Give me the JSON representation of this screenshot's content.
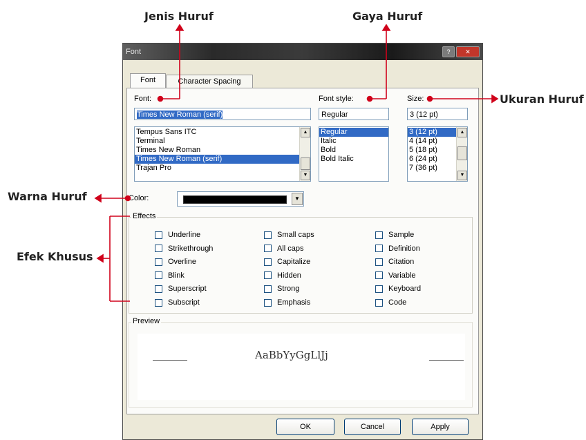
{
  "annotations": {
    "font_type": "Jenis Huruf",
    "font_style": "Gaya Huruf",
    "font_size": "Ukuran Huruf",
    "font_color": "Warna Huruf",
    "effects": "Efek Khusus",
    "accent_color": "#d0021b"
  },
  "dialog": {
    "title": "Font",
    "tabs": [
      "Font",
      "Character Spacing"
    ],
    "font_label": "Font:",
    "font_value": "Times New Roman (serif)",
    "font_list": [
      "Tempus Sans ITC",
      "Terminal",
      "Times New Roman",
      "Times New Roman (serif)",
      "Trajan Pro"
    ],
    "style_label": "Font style:",
    "style_value": "Regular",
    "style_list": [
      "Regular",
      "Italic",
      "Bold",
      "Bold Italic"
    ],
    "size_label": "Size:",
    "size_value": "3  (12 pt)",
    "size_list": [
      "3  (12 pt)",
      "4  (14 pt)",
      "5  (18 pt)",
      "6  (24 pt)",
      "7  (36 pt)"
    ],
    "color_label": "Color:",
    "color_value": "#000000",
    "effects_label": "Effects",
    "effects_col1": [
      "Underline",
      "Strikethrough",
      "Overline",
      "Blink",
      "Superscript",
      "Subscript"
    ],
    "effects_col2": [
      "Small caps",
      "All caps",
      "Capitalize",
      "Hidden",
      "Strong",
      "Emphasis"
    ],
    "effects_col3": [
      "Sample",
      "Definition",
      "Citation",
      "Variable",
      "Keyboard",
      "Code"
    ],
    "preview_label": "Preview",
    "preview_text": "AaBbYyGgLlJj",
    "ok_label": "OK",
    "cancel_label": "Cancel",
    "apply_label": "Apply"
  }
}
